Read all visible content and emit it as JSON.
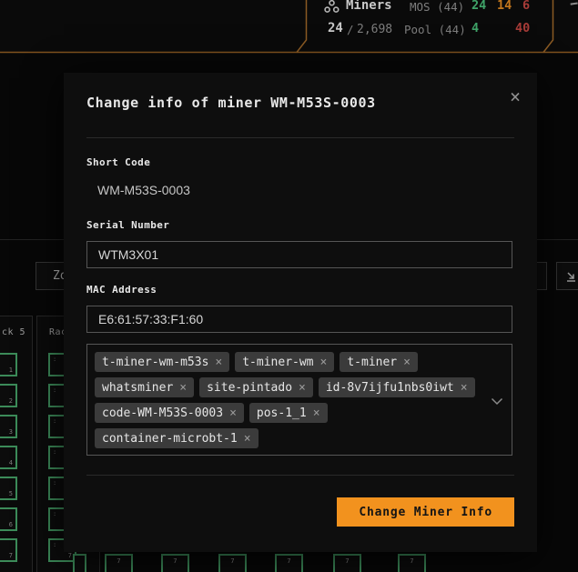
{
  "topbar": {
    "miners": {
      "label": "Miners",
      "group": "MOS (44)",
      "ok": "24",
      "warn": "14",
      "err": "6"
    },
    "pool": {
      "count": "24",
      "sep": "/",
      "total": "2,698",
      "group": "Pool (44)",
      "ok": "4",
      "err": "40"
    }
  },
  "toolbar": {
    "zoom_label": "Zo"
  },
  "background": {
    "rack_left": {
      "title": "ck 5"
    },
    "rack_right": {
      "title": "Rack"
    },
    "cell_numbers": [
      "1",
      "2",
      "3",
      "4",
      "5",
      "6",
      "7"
    ],
    "cell_detail_mark": ":",
    "bottom_cells": [
      "7",
      "7",
      "7",
      "7",
      "7",
      "7"
    ]
  },
  "modal": {
    "title": "Change info of miner WM-M53S-0003",
    "close_glyph": "×",
    "short_code": {
      "label": "Short Code",
      "value": "WM-M53S-0003"
    },
    "serial_number": {
      "label": "Serial Number",
      "value": "WTM3X01"
    },
    "mac_address": {
      "label": "MAC Address",
      "value": "E6:61:57:33:F1:60"
    },
    "tags": [
      "t-miner-wm-m53s",
      "t-miner-wm",
      "t-miner",
      "whatsminer",
      "site-pintado",
      "id-8v7ijfu1nbs0iwt",
      "code-WM-M53S-0003",
      "pos-1_1",
      "container-microbt-1"
    ],
    "tag_remove_glyph": "×",
    "submit_label": "Change Miner Info"
  },
  "colors": {
    "accent_orange": "#F2921E",
    "panel_outline": "#8A5A23",
    "status_green": "#3FA368",
    "status_orange": "#C2761D",
    "status_red": "#A83C38",
    "rack_cell_green": "#3C8B59"
  }
}
